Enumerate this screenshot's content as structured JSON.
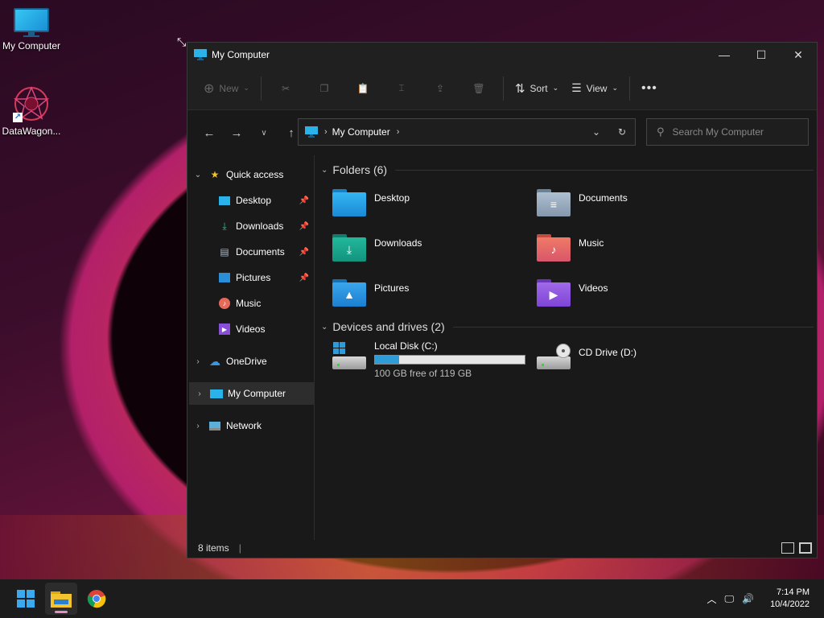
{
  "desktop": {
    "icons": [
      {
        "label": "My Computer",
        "icon": "monitor-icon"
      },
      {
        "label": "DataWagon...",
        "icon": "app-logo-icon"
      }
    ]
  },
  "window": {
    "title": "My Computer",
    "controls": {
      "minimize": "minimize-icon",
      "maximize": "maximize-icon",
      "close": "close-icon"
    }
  },
  "toolbar": {
    "new_label": "New",
    "sort_label": "Sort",
    "view_label": "View",
    "icons": [
      "cut-icon",
      "copy-icon",
      "paste-icon",
      "rename-icon",
      "share-icon",
      "delete-icon",
      "more-icon"
    ]
  },
  "address": {
    "crumb": "My Computer",
    "search_placeholder": "Search My Computer"
  },
  "sidebar": {
    "items": [
      {
        "label": "Quick access",
        "icon": "star-icon"
      },
      {
        "label": "Desktop",
        "icon": "desktop-folder-icon",
        "pinned": true
      },
      {
        "label": "Downloads",
        "icon": "download-icon",
        "pinned": true
      },
      {
        "label": "Documents",
        "icon": "document-icon",
        "pinned": true
      },
      {
        "label": "Pictures",
        "icon": "picture-icon",
        "pinned": true
      },
      {
        "label": "Music",
        "icon": "music-icon"
      },
      {
        "label": "Videos",
        "icon": "video-icon"
      },
      {
        "label": "OneDrive",
        "icon": "cloud-icon"
      },
      {
        "label": "My Computer",
        "icon": "monitor-icon",
        "selected": true
      },
      {
        "label": "Network",
        "icon": "network-icon"
      }
    ]
  },
  "main": {
    "folders_header": "Folders (6)",
    "folders": [
      {
        "name": "Desktop",
        "color": "#1e9be0"
      },
      {
        "name": "Documents",
        "color": "#8aa2b8"
      },
      {
        "name": "Downloads",
        "color": "#16a08a"
      },
      {
        "name": "Music",
        "color": "#e56a5a"
      },
      {
        "name": "Pictures",
        "color": "#2a8fd8"
      },
      {
        "name": "Videos",
        "color": "#8a4fd8"
      }
    ],
    "drives_header": "Devices and drives (2)",
    "drives": [
      {
        "name": "Local Disk (C:)",
        "free": "100 GB free of 119 GB",
        "used_fraction": 0.16
      },
      {
        "name": "CD Drive (D:)"
      }
    ]
  },
  "status": {
    "items": "8 items"
  },
  "taskbar": {
    "time": "7:14 PM",
    "date": "10/4/2022"
  }
}
